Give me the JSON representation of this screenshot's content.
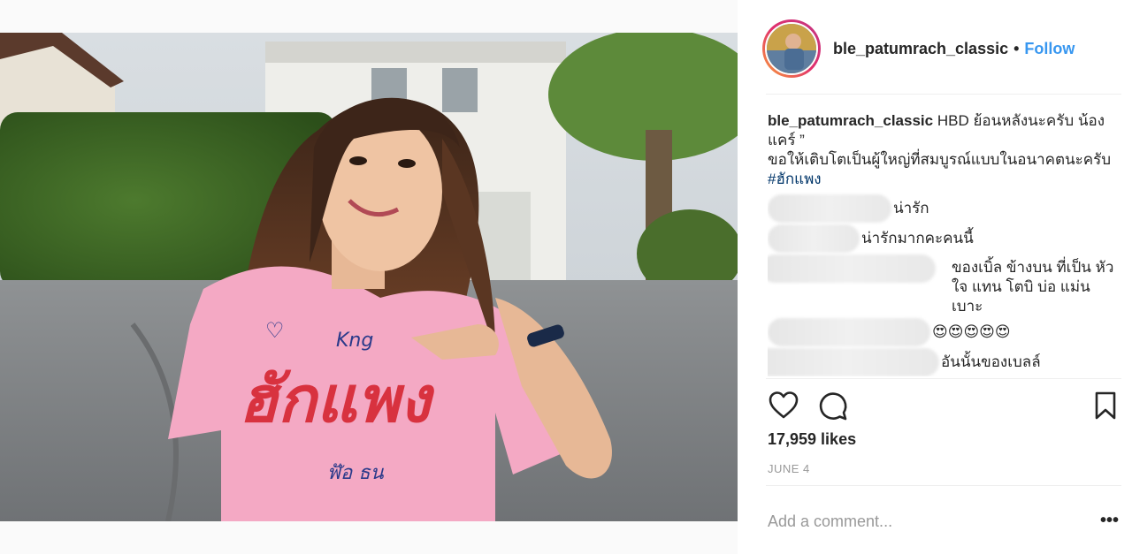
{
  "post": {
    "image_alt": "Girl in pink shirt pointing at her shirt"
  },
  "header": {
    "username": "ble_patumrach_classic",
    "separator": "•",
    "follow_label": "Follow"
  },
  "caption": {
    "user": "ble_patumrach_classic",
    "text_line1": " HBD ย้อนหลังนะครับ น้องแคร์ ”",
    "text_line2": "ขอให้เติบโตเป็นผู้ใหญ่ที่สมบูรณ์แบบในอนาคตนะครับ ",
    "hashtag": "#ฮักแพง"
  },
  "comments": [
    {
      "text": "น่ารัก"
    },
    {
      "text": "น่ารักมากคะคนนี้"
    },
    {
      "text": "ของเบิ้ล ข้างบน ที่เป็น หัว ใจ แทน โตบิ บ่อ แม่น เบาะ"
    },
    {
      "text": "😍😍😍😍😍"
    },
    {
      "text": "อันนั้นของเบลล์"
    }
  ],
  "actions": {
    "like_icon": "heart-icon",
    "comment_icon": "comment-icon",
    "save_icon": "bookmark-icon"
  },
  "likes": "17,959 likes",
  "date": "JUNE 4",
  "add_comment": {
    "placeholder": "Add a comment..."
  },
  "more_label": "•••",
  "colors": {
    "follow": "#3897f0",
    "shirt": "#f4a9c4",
    "text": "#262626",
    "muted": "#999999"
  }
}
